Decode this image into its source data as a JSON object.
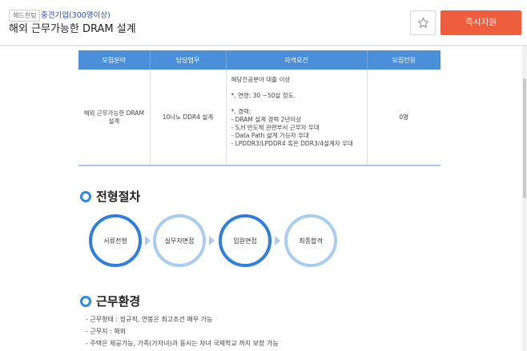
{
  "header": {
    "badge": "헤드헌팅",
    "company": "중견기업(300명이상)",
    "title": "해외 근무가능한 DRAM 설계",
    "apply_label": "즉시지원"
  },
  "table": {
    "headers": [
      "모집분야",
      "담당업무",
      "자격요건",
      "모집인원"
    ],
    "field": "해외 근무가능한 DRAM 설계",
    "duty": "10나노 DDR4 설계",
    "qualifications": [
      "해당전공분야 대졸 이상",
      "",
      "*. 연령: 30 ~50살 정도.",
      "",
      "*. 경력:",
      "- DRAM 설계 경력 2년이상",
      "- S,H 반도체 관련부서 근무자 우대",
      "- Data Path 설계 가능자 우대",
      "- LPDDR3/LPDDR4 혹은 DDR3/4설계자 우대"
    ],
    "headcount": "0명"
  },
  "process": {
    "title": "전형절차",
    "steps": [
      "서류전형",
      "실무자면접",
      "임원면접",
      "최종합격"
    ]
  },
  "environment": {
    "title": "근무환경",
    "items": [
      "- 근무형태 : 정규직, 연봉은 최고조건 매우 가능",
      "- 근무지 : 해외",
      "- 주택은 제공가능, 가족(가자녀)과 동시는 자녀 국제학교 까지 보장 가능"
    ]
  }
}
